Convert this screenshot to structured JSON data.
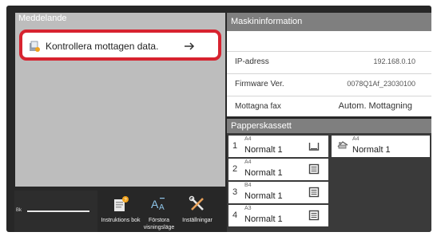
{
  "messages": {
    "title": "Meddelande",
    "item_text": "Kontrollera mottagen data.",
    "accent_color": "#d7232f"
  },
  "toner": {
    "label": "Bk",
    "level": 1.0
  },
  "bottom_buttons": [
    {
      "label": "Instruktions bok",
      "icon": "manual-book-icon"
    },
    {
      "label": "Förstora visningsläge",
      "icon": "font-enlarge-icon"
    },
    {
      "label": "Inställningar",
      "icon": "settings-tools-icon"
    }
  ],
  "machine_info": {
    "title": "Maskininformation",
    "rows": [
      {
        "label": "IP-adress",
        "value": "192.168.0.10"
      },
      {
        "label": "Firmware Ver.",
        "value": "0078Q1Af_23030100"
      },
      {
        "label": "Mottagna fax",
        "value": "Autom. Mottagning"
      }
    ]
  },
  "paper_trays": {
    "title": "Papperskassett",
    "trays": [
      {
        "number": "1",
        "size": "A4",
        "type": "Normalt 1",
        "icon": "tray-empty-icon"
      },
      {
        "number": "2",
        "size": "A4",
        "type": "Normalt 1",
        "icon": "tray-full-icon"
      },
      {
        "number": "3",
        "size": "B4",
        "type": "Normalt 1",
        "icon": "tray-full-icon"
      },
      {
        "number": "4",
        "size": "A3",
        "type": "Normalt 1",
        "icon": "tray-full-icon"
      }
    ],
    "bypass": {
      "size": "A4",
      "type": "Normalt 1",
      "icon": "bypass-tray-icon"
    }
  }
}
